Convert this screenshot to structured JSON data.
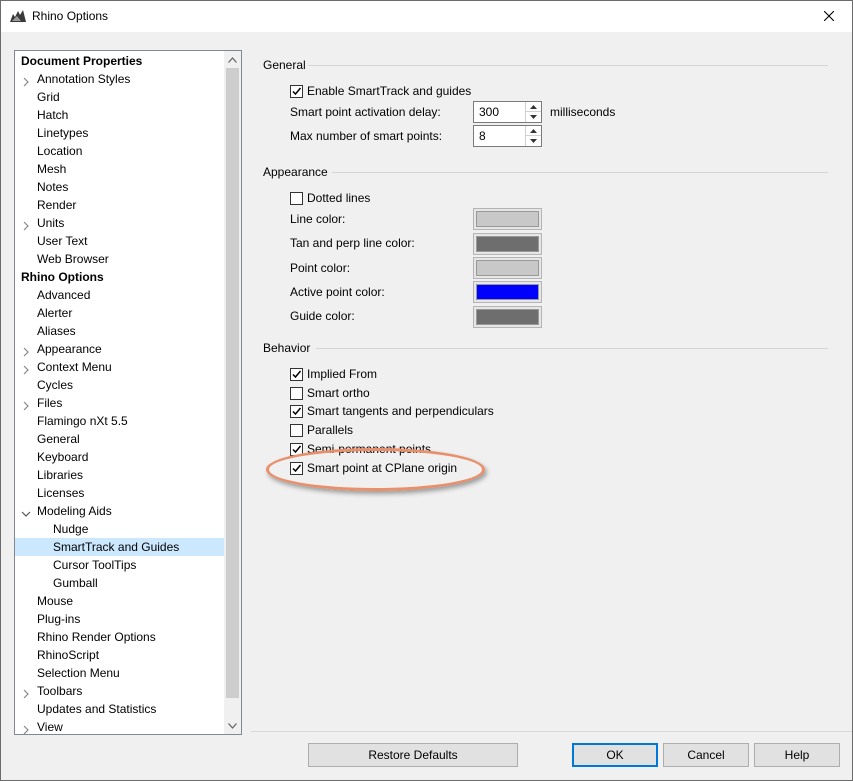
{
  "window": {
    "title": "Rhino Options",
    "close_icon": "close-icon"
  },
  "tree": {
    "items": [
      {
        "label": "Document Properties",
        "bold": true,
        "indent": 0,
        "chevron": "none"
      },
      {
        "label": "Annotation Styles",
        "indent": 1,
        "chevron": "right"
      },
      {
        "label": "Grid",
        "indent": 1,
        "chevron": "none"
      },
      {
        "label": "Hatch",
        "indent": 1,
        "chevron": "none"
      },
      {
        "label": "Linetypes",
        "indent": 1,
        "chevron": "none"
      },
      {
        "label": "Location",
        "indent": 1,
        "chevron": "none"
      },
      {
        "label": "Mesh",
        "indent": 1,
        "chevron": "none"
      },
      {
        "label": "Notes",
        "indent": 1,
        "chevron": "none"
      },
      {
        "label": "Render",
        "indent": 1,
        "chevron": "none"
      },
      {
        "label": "Units",
        "indent": 1,
        "chevron": "right"
      },
      {
        "label": "User Text",
        "indent": 1,
        "chevron": "none"
      },
      {
        "label": "Web Browser",
        "indent": 1,
        "chevron": "none"
      },
      {
        "label": "Rhino Options",
        "bold": true,
        "indent": 0,
        "chevron": "none"
      },
      {
        "label": "Advanced",
        "indent": 1,
        "chevron": "none"
      },
      {
        "label": "Alerter",
        "indent": 1,
        "chevron": "none"
      },
      {
        "label": "Aliases",
        "indent": 1,
        "chevron": "none"
      },
      {
        "label": "Appearance",
        "indent": 1,
        "chevron": "right"
      },
      {
        "label": "Context Menu",
        "indent": 1,
        "chevron": "right"
      },
      {
        "label": "Cycles",
        "indent": 1,
        "chevron": "none"
      },
      {
        "label": "Files",
        "indent": 1,
        "chevron": "right"
      },
      {
        "label": "Flamingo nXt 5.5",
        "indent": 1,
        "chevron": "none"
      },
      {
        "label": "General",
        "indent": 1,
        "chevron": "none"
      },
      {
        "label": "Keyboard",
        "indent": 1,
        "chevron": "none"
      },
      {
        "label": "Libraries",
        "indent": 1,
        "chevron": "none"
      },
      {
        "label": "Licenses",
        "indent": 1,
        "chevron": "none"
      },
      {
        "label": "Modeling Aids",
        "indent": 1,
        "chevron": "down"
      },
      {
        "label": "Nudge",
        "indent": 2,
        "chevron": "none"
      },
      {
        "label": "SmartTrack and Guides",
        "indent": 2,
        "chevron": "none",
        "selected": true
      },
      {
        "label": "Cursor ToolTips",
        "indent": 2,
        "chevron": "none"
      },
      {
        "label": "Gumball",
        "indent": 2,
        "chevron": "none"
      },
      {
        "label": "Mouse",
        "indent": 1,
        "chevron": "none"
      },
      {
        "label": "Plug-ins",
        "indent": 1,
        "chevron": "none"
      },
      {
        "label": "Rhino Render Options",
        "indent": 1,
        "chevron": "none"
      },
      {
        "label": "RhinoScript",
        "indent": 1,
        "chevron": "none"
      },
      {
        "label": "Selection Menu",
        "indent": 1,
        "chevron": "none"
      },
      {
        "label": "Toolbars",
        "indent": 1,
        "chevron": "right"
      },
      {
        "label": "Updates and Statistics",
        "indent": 1,
        "chevron": "none"
      },
      {
        "label": "View",
        "indent": 1,
        "chevron": "right"
      }
    ]
  },
  "general": {
    "title": "General",
    "enable_label": "Enable SmartTrack and guides",
    "enable_checked": true,
    "delay_label": "Smart point activation delay:",
    "delay_value": "300",
    "delay_units": "milliseconds",
    "max_label": "Max number of smart points:",
    "max_value": "8"
  },
  "appearance": {
    "title": "Appearance",
    "dotted_label": "Dotted lines",
    "dotted_checked": false,
    "colors": [
      {
        "label": "Line color:",
        "color": "#c8c8c8"
      },
      {
        "label": "Tan and perp line color:",
        "color": "#6e6e6e"
      },
      {
        "label": "Point color:",
        "color": "#c8c8c8"
      },
      {
        "label": "Active point color:",
        "color": "#0000ff"
      },
      {
        "label": "Guide color:",
        "color": "#6e6e6e"
      }
    ]
  },
  "behavior": {
    "title": "Behavior",
    "options": [
      {
        "label": "Implied From",
        "checked": true
      },
      {
        "label": "Smart ortho",
        "checked": false
      },
      {
        "label": "Smart tangents and perpendiculars",
        "checked": true
      },
      {
        "label": "Parallels",
        "checked": false
      },
      {
        "label": "Semi-permanent points",
        "checked": true
      },
      {
        "label": "Smart point at CPlane origin",
        "checked": true
      }
    ]
  },
  "buttons": {
    "restore": "Restore Defaults",
    "ok": "OK",
    "cancel": "Cancel",
    "help": "Help"
  },
  "colors": {
    "accent": "#0078d7",
    "selection": "#cce8ff",
    "highlight_ellipse": "#e8906a"
  }
}
